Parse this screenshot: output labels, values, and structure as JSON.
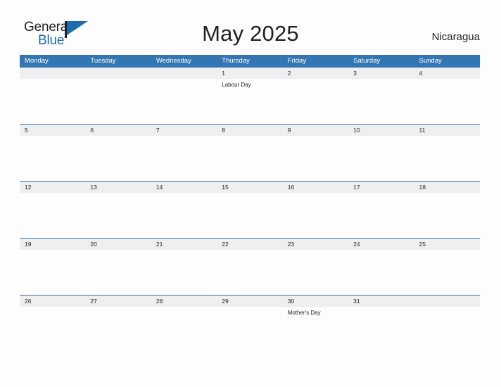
{
  "brand": {
    "word_one": "General",
    "word_two": "Blue",
    "flag_icon": "flag-icon",
    "accent_color": "#1b6cb0",
    "text_color": "#231f20"
  },
  "header": {
    "title": "May 2025",
    "region": "Nicaragua"
  },
  "colors": {
    "header_blue": "#3376b4",
    "date_band_gray": "#efefef",
    "page_background": "#fdfdfd",
    "body_text": "#231f20"
  },
  "calendar": {
    "month": "May",
    "year": "2025",
    "weekday_headers": [
      "Monday",
      "Tuesday",
      "Wednesday",
      "Thursday",
      "Friday",
      "Saturday",
      "Sunday"
    ],
    "weeks": [
      {
        "days": [
          {
            "num": "",
            "events": []
          },
          {
            "num": "",
            "events": []
          },
          {
            "num": "",
            "events": []
          },
          {
            "num": "1",
            "events": [
              "Labour Day"
            ]
          },
          {
            "num": "2",
            "events": []
          },
          {
            "num": "3",
            "events": []
          },
          {
            "num": "4",
            "events": []
          }
        ]
      },
      {
        "days": [
          {
            "num": "5",
            "events": []
          },
          {
            "num": "6",
            "events": []
          },
          {
            "num": "7",
            "events": []
          },
          {
            "num": "8",
            "events": []
          },
          {
            "num": "9",
            "events": []
          },
          {
            "num": "10",
            "events": []
          },
          {
            "num": "11",
            "events": []
          }
        ]
      },
      {
        "days": [
          {
            "num": "12",
            "events": []
          },
          {
            "num": "13",
            "events": []
          },
          {
            "num": "14",
            "events": []
          },
          {
            "num": "15",
            "events": []
          },
          {
            "num": "16",
            "events": []
          },
          {
            "num": "17",
            "events": []
          },
          {
            "num": "18",
            "events": []
          }
        ]
      },
      {
        "days": [
          {
            "num": "19",
            "events": []
          },
          {
            "num": "20",
            "events": []
          },
          {
            "num": "21",
            "events": []
          },
          {
            "num": "22",
            "events": []
          },
          {
            "num": "23",
            "events": []
          },
          {
            "num": "24",
            "events": []
          },
          {
            "num": "25",
            "events": []
          }
        ]
      },
      {
        "days": [
          {
            "num": "26",
            "events": []
          },
          {
            "num": "27",
            "events": []
          },
          {
            "num": "28",
            "events": []
          },
          {
            "num": "29",
            "events": []
          },
          {
            "num": "30",
            "events": [
              "Mother's Day"
            ]
          },
          {
            "num": "31",
            "events": []
          },
          {
            "num": "",
            "events": []
          }
        ]
      }
    ]
  }
}
